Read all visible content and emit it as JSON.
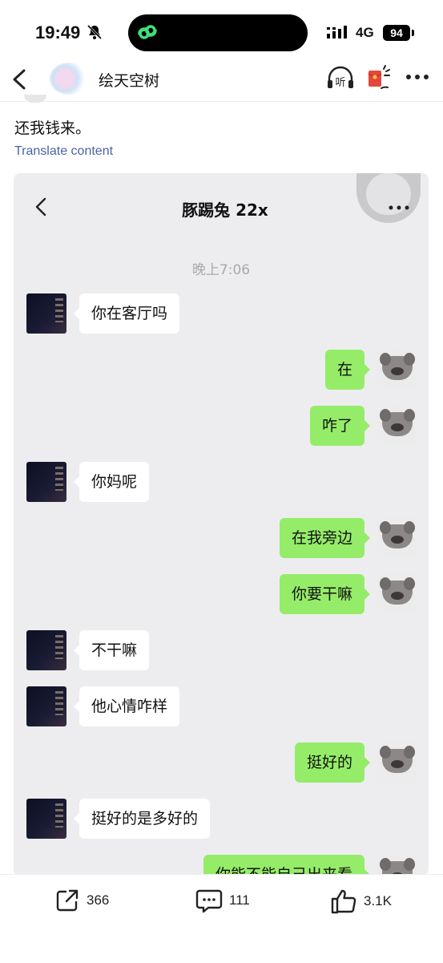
{
  "status_bar": {
    "time": "19:49",
    "network": "4G",
    "battery": "94"
  },
  "header": {
    "username": "绘天空树",
    "listen_label": "听"
  },
  "post": {
    "text": "还我钱来。",
    "translate_label": "Translate content"
  },
  "chat": {
    "contact": "豚踢兔 22x",
    "timestamp": "晚上7:06",
    "messages": [
      {
        "side": "in",
        "text": "你在客厅吗"
      },
      {
        "side": "out",
        "text": "在"
      },
      {
        "side": "out",
        "text": "咋了"
      },
      {
        "side": "in",
        "text": "你妈呢"
      },
      {
        "side": "out",
        "text": "在我旁边"
      },
      {
        "side": "out",
        "text": "你要干嘛"
      },
      {
        "side": "in",
        "text": "不干嘛"
      },
      {
        "side": "in",
        "text": "他心情咋样"
      },
      {
        "side": "out",
        "text": "挺好的"
      },
      {
        "side": "in",
        "text": "挺好的是多好的"
      },
      {
        "side": "out",
        "text": "你能不能自己出来看"
      }
    ]
  },
  "actions": {
    "share_count": "366",
    "comment_count": "111",
    "like_count": "3.1K"
  },
  "icons": [
    "back-icon",
    "headphones-icon",
    "red-packet-icon",
    "more-icon",
    "share-icon",
    "comment-icon",
    "like-icon",
    "mute-bell-icon"
  ],
  "colors": {
    "chat_bg": "#ededf0",
    "outgoing_bubble": "#95ec69",
    "incoming_bubble": "#ffffff",
    "link": "#4a63a4"
  }
}
